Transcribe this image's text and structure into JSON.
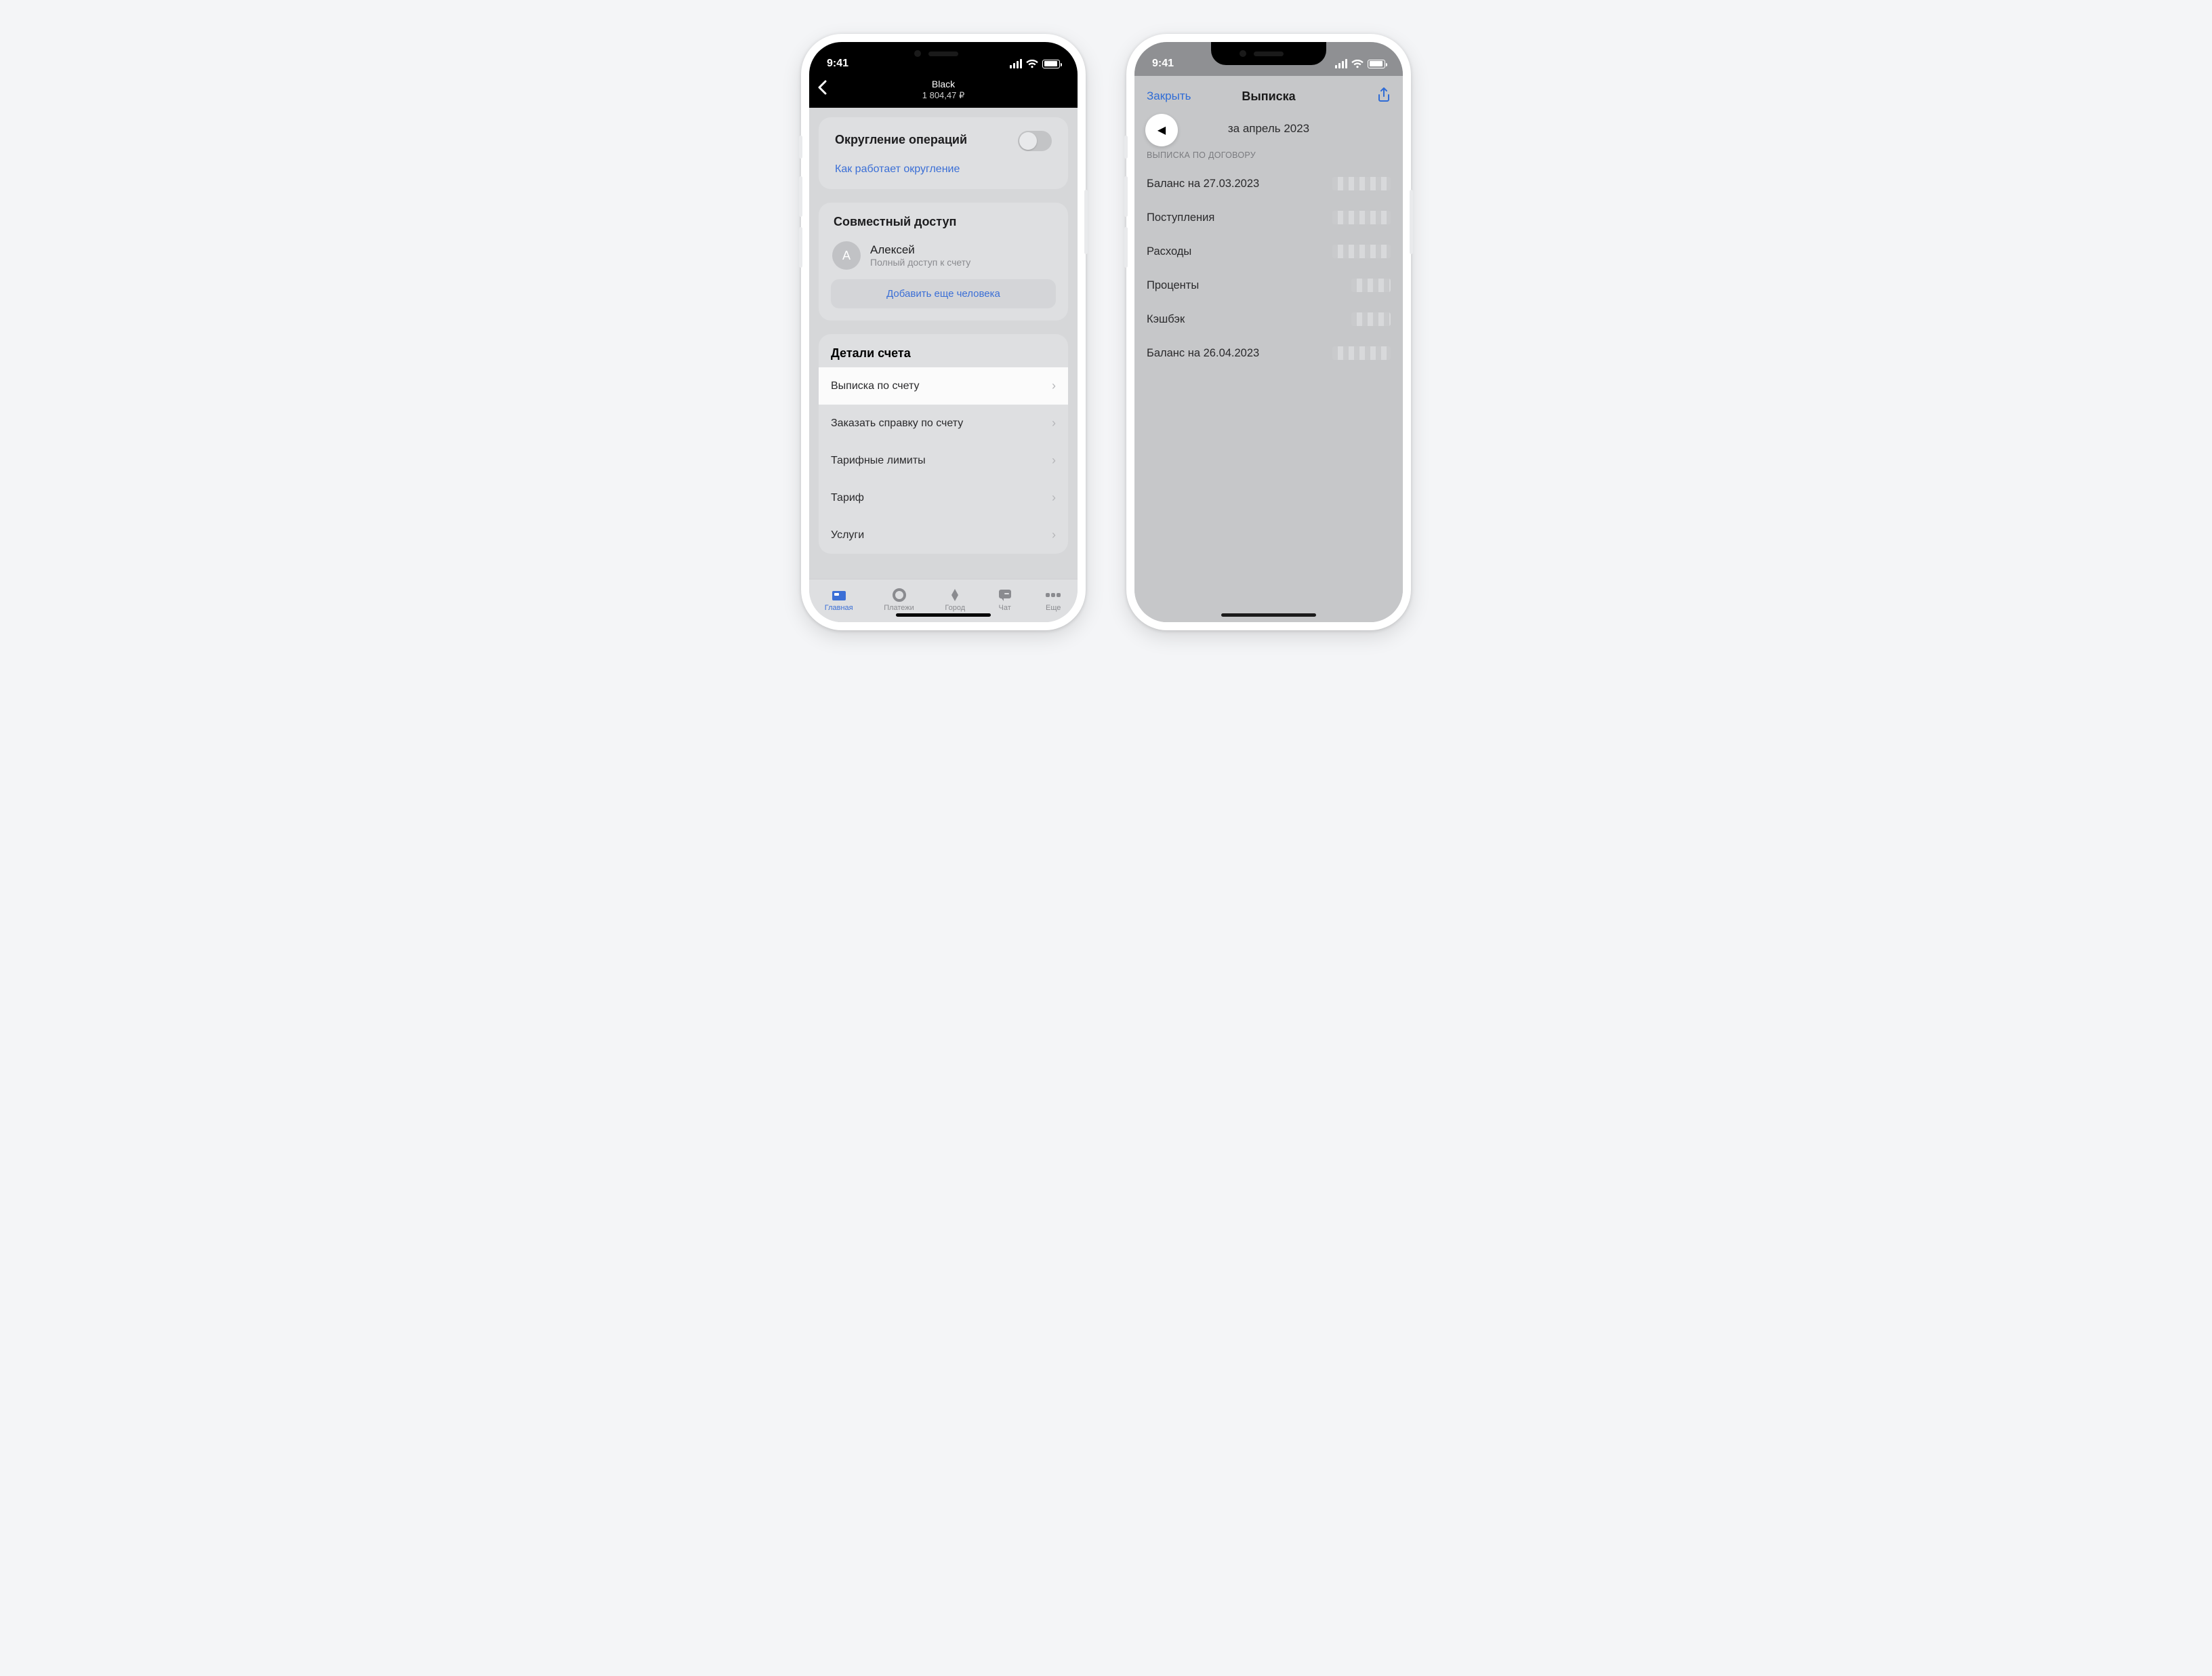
{
  "status": {
    "time": "9:41"
  },
  "left": {
    "header": {
      "title": "Black",
      "balance": "1 804,47 ₽"
    },
    "rounding": {
      "title": "Округление операций",
      "help": "Как работает округление"
    },
    "shared": {
      "title": "Совместный доступ",
      "user_initial": "А",
      "user_name": "Алексей",
      "user_role": "Полный доступ к счету",
      "add": "Добавить еще человека"
    },
    "details": {
      "title": "Детали счета",
      "items": [
        "Выписка по счету",
        "Заказать справку по счету",
        "Тарифные лимиты",
        "Тариф",
        "Услуги"
      ]
    },
    "tabs": [
      "Главная",
      "Платежи",
      "Город",
      "Чат",
      "Еще"
    ]
  },
  "right": {
    "close": "Закрыть",
    "title": "Выписка",
    "period": "за апрель 2023",
    "section": "Выписка по договору",
    "rows": [
      "Баланс на 27.03.2023",
      "Поступления",
      "Расходы",
      "Проценты",
      "Кэшбэк",
      "Баланс на 26.04.2023"
    ]
  }
}
